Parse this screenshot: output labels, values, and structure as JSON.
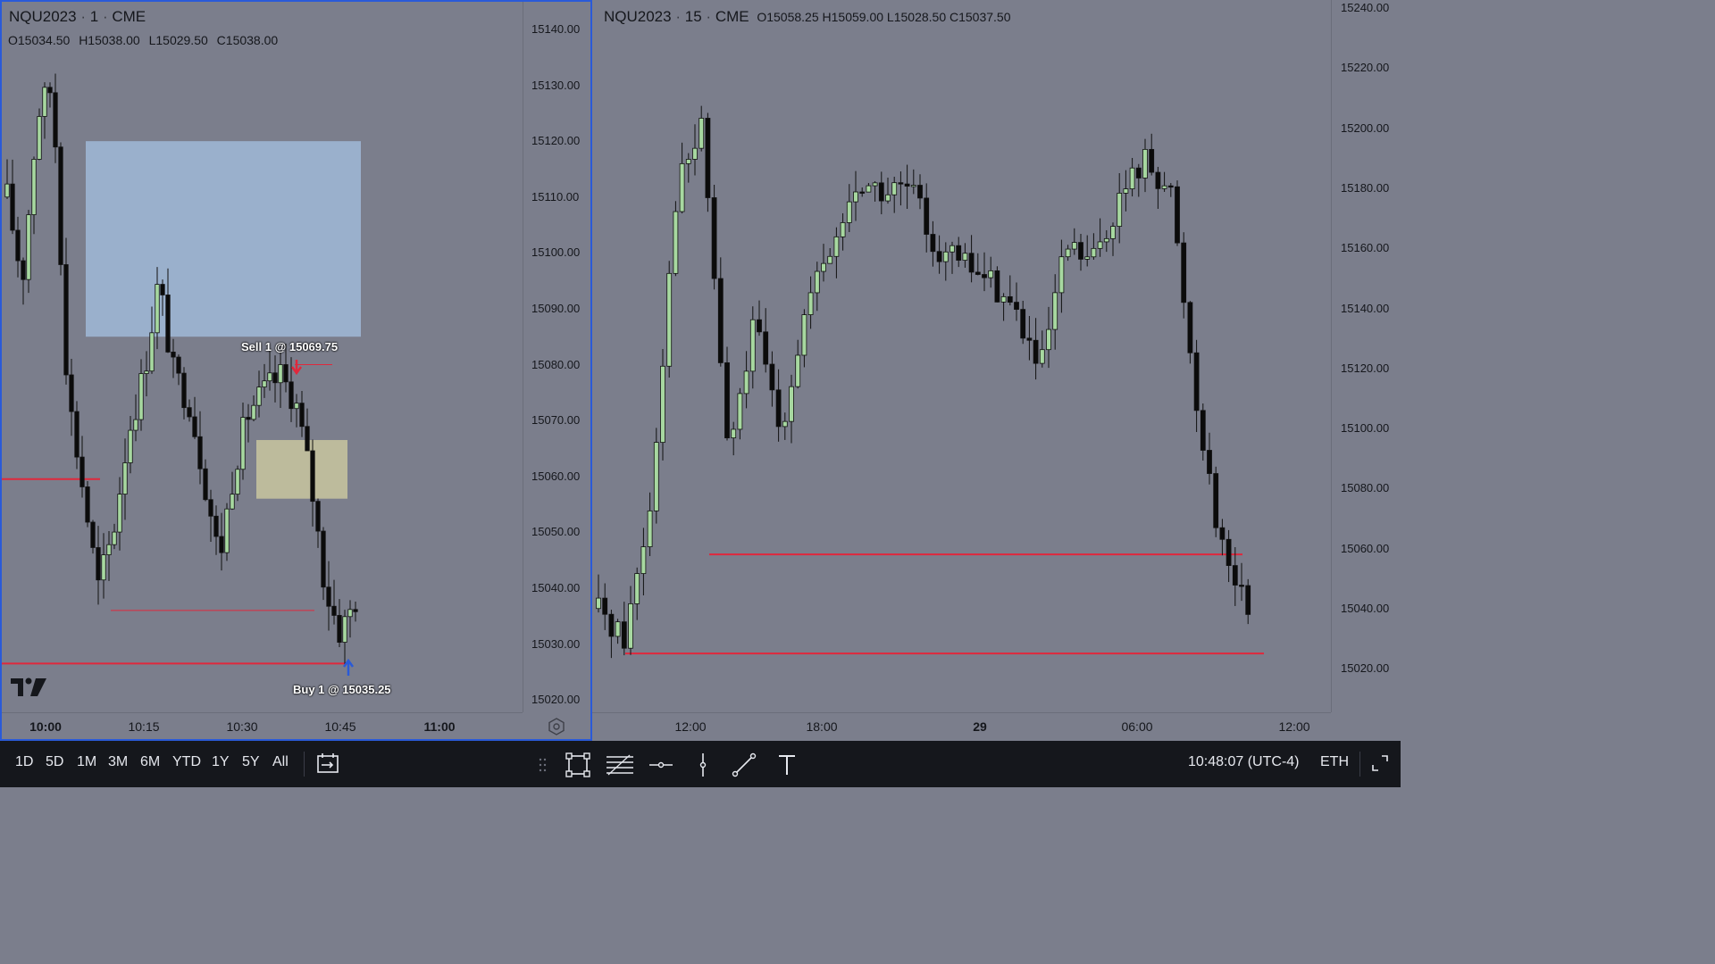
{
  "left_chart": {
    "symbol": "NQU2023",
    "interval": "1",
    "exchange": "CME",
    "ohlc": {
      "o": "O15034.50",
      "h": "H15038.00",
      "l": "L15029.50",
      "c": "C15038.00"
    },
    "price_labels": [
      "15140.00",
      "15130.00",
      "15120.00",
      "15110.00",
      "15100.00",
      "15090.00",
      "15080.00",
      "15070.00",
      "15060.00",
      "15050.00",
      "15040.00",
      "15030.00",
      "15020.00"
    ],
    "time_labels": [
      {
        "text": "10:00",
        "bold": true
      },
      {
        "text": "10:15",
        "bold": false
      },
      {
        "text": "10:30",
        "bold": false
      },
      {
        "text": "10:45",
        "bold": false
      },
      {
        "text": "11:00",
        "bold": true
      }
    ],
    "sell_label": "Sell 1 @ 15069.75",
    "buy_label": "Buy 1 @ 15035.25",
    "logo": "TV"
  },
  "right_chart": {
    "symbol": "NQU2023",
    "interval": "15",
    "exchange": "CME",
    "ohlc": {
      "o": "O15058.25",
      "h": "H15059.00",
      "l": "L15028.50",
      "c": "C15037.50"
    },
    "price_labels": [
      "15240.00",
      "15220.00",
      "15200.00",
      "15180.00",
      "15160.00",
      "15140.00",
      "15120.00",
      "15100.00",
      "15080.00",
      "15060.00",
      "15040.00",
      "15020.00"
    ],
    "time_labels": [
      {
        "text": "12:00",
        "bold": false
      },
      {
        "text": "18:00",
        "bold": false
      },
      {
        "text": "29",
        "bold": true
      },
      {
        "text": "06:00",
        "bold": false
      },
      {
        "text": "12:00",
        "bold": false
      }
    ]
  },
  "bottom_bar": {
    "timeframes": [
      "1D",
      "5D",
      "1M",
      "3M",
      "6M",
      "YTD",
      "1Y",
      "5Y",
      "All"
    ],
    "time": "10:48:07 (UTC-4)",
    "session": "ETH"
  },
  "colors": {
    "bull": "#a7d8a0",
    "bear": "#0b0b0b",
    "level": "#e0283c",
    "zone_blue": "#9ab0cc",
    "zone_yellow": "#bdbb9c",
    "pane_border": "#2a5ad8"
  }
}
